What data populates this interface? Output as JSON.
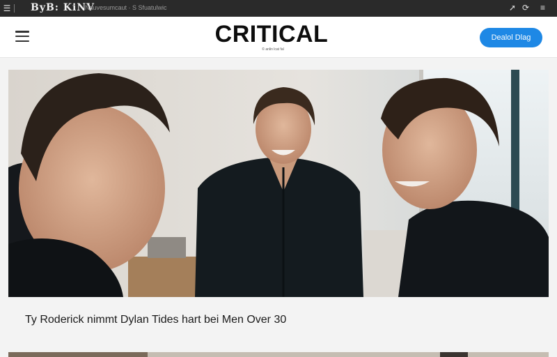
{
  "topbar": {
    "left_icons": [
      "menu-icon"
    ],
    "logo_text": "ByB: KiNV",
    "subtitle": "Nauvesumcaut · S Sfuatulwic",
    "right_icons": [
      "pin-icon",
      "refresh-icon",
      "menu-icon"
    ]
  },
  "header": {
    "brand": "CRITICAL",
    "tagline": "© anlin lcat fal",
    "cta_label": "Dealol Dlag",
    "accent": "#1e88e5"
  },
  "article": {
    "headline": "Ty Roderick nimmt Dylan Tides hart bei Men Over 30"
  }
}
